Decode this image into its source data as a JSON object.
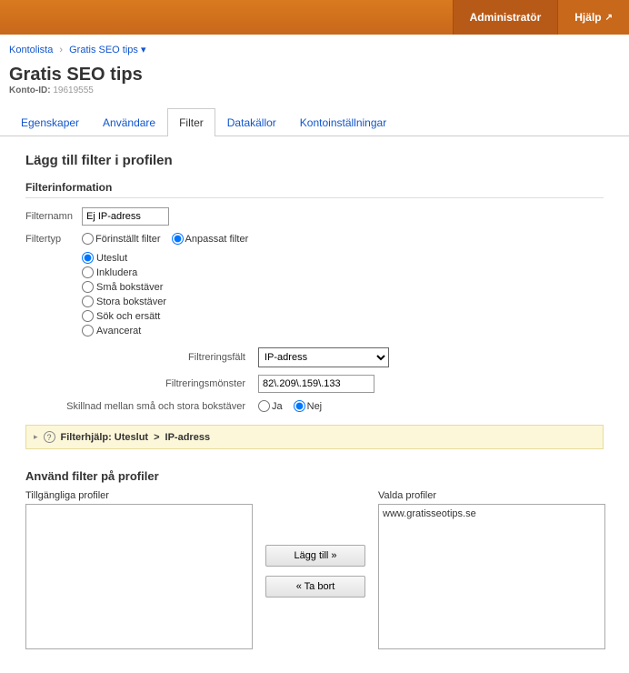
{
  "topbar": {
    "admin": "Administratör",
    "help": "Hjälp"
  },
  "breadcrumb": {
    "account": "Kontolista",
    "property": "Gratis SEO tips"
  },
  "page": {
    "title": "Gratis SEO tips",
    "account_id_label": "Konto-ID:",
    "account_id": "19619555"
  },
  "tabs": [
    "Egenskaper",
    "Användare",
    "Filter",
    "Datakällor",
    "Kontoinställningar"
  ],
  "section": {
    "heading": "Lägg till filter i profilen",
    "info": "Filterinformation"
  },
  "form": {
    "name_label": "Filternamn",
    "name_value": "Ej IP-adress",
    "type_label": "Filtertyp",
    "type_preset": "Förinställt filter",
    "type_custom": "Anpassat filter",
    "modes": [
      "Uteslut",
      "Inkludera",
      "Små bokstäver",
      "Stora bokstäver",
      "Sök och ersätt",
      "Avancerat"
    ],
    "field_label": "Filtreringsfält",
    "field_value": "IP-adress",
    "pattern_label": "Filtreringsmönster",
    "pattern_value": "82\\.209\\.159\\.133",
    "case_label": "Skillnad mellan små och stora bokstäver",
    "case_yes": "Ja",
    "case_no": "Nej"
  },
  "help": {
    "prefix": "Filterhjälp: Uteslut",
    "sep": ">",
    "suffix": "IP-adress"
  },
  "apply": {
    "heading": "Använd filter på profiler",
    "available": "Tillgängliga profiler",
    "selected": "Valda profiler",
    "add": "Lägg till »",
    "remove": "« Ta bort",
    "selected_items": [
      "www.gratisseotips.se"
    ]
  }
}
